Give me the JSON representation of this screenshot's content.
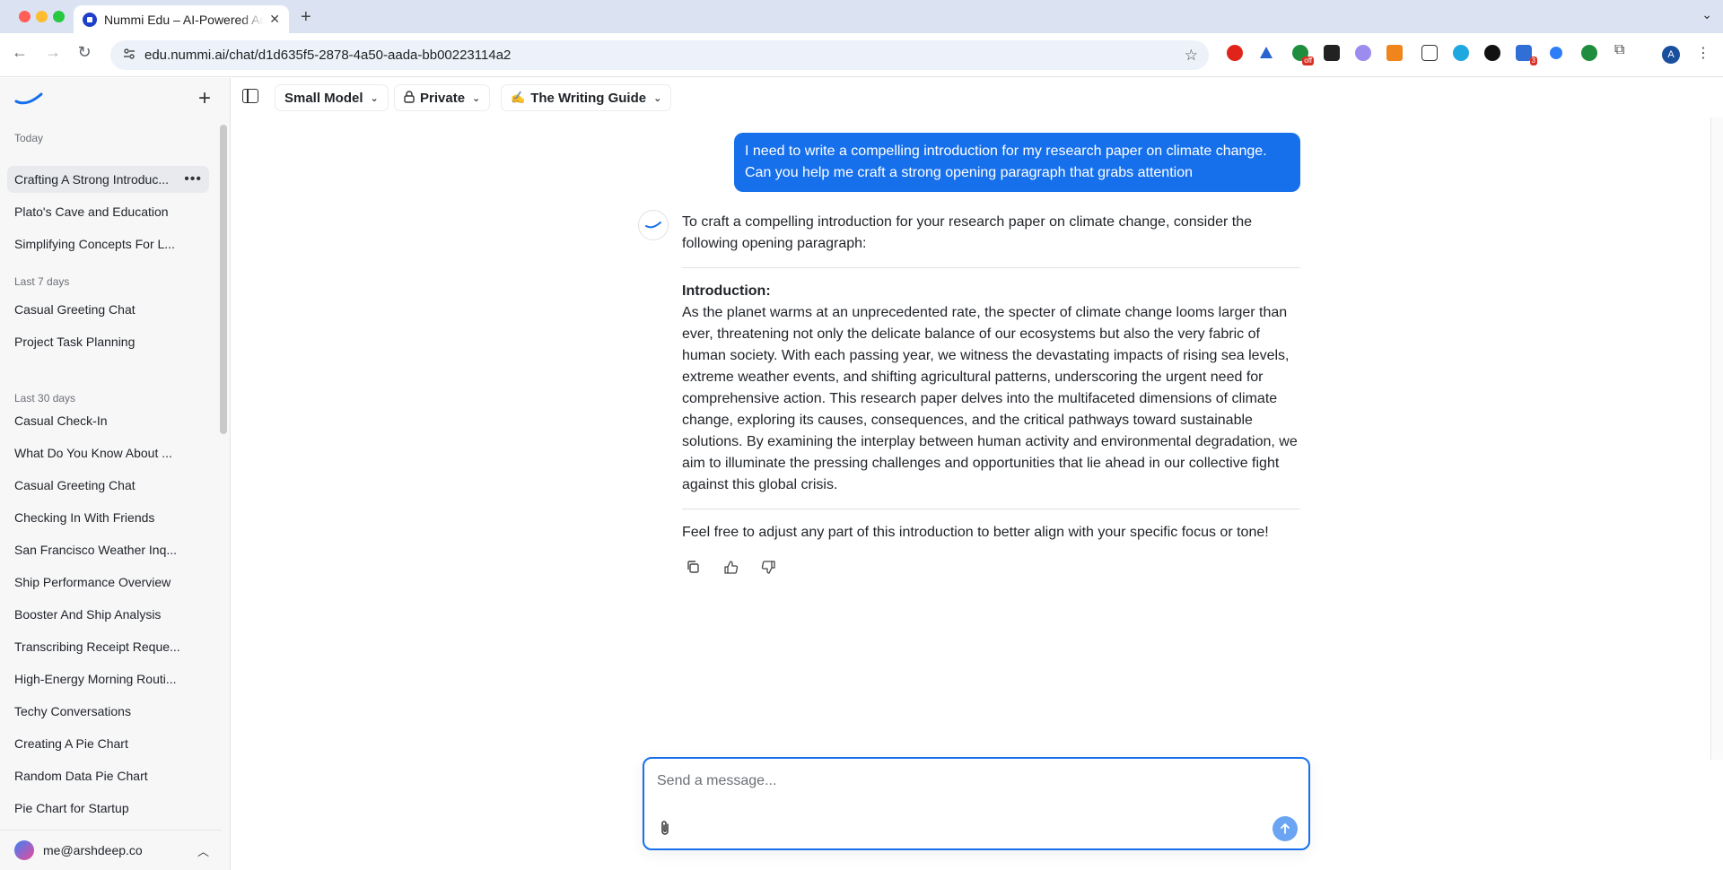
{
  "browser": {
    "tab_title": "Nummi Edu – AI-Powered Academic",
    "url": "edu.nummi.ai/chat/d1d635f5-2878-4a50-aada-bb00223114a2",
    "extensions": [
      "opera-icon",
      "drive-icon",
      "off-badge-extension-icon",
      "f-extension-icon",
      "chat-extension-icon",
      "metamask-icon",
      "tab-extension-icon",
      "globe-extension-icon",
      "dot-extension-icon",
      "grid-extension-icon",
      "blue-dot-extension-icon",
      "cursor-extension-icon",
      "puzzle-icon"
    ],
    "ext_badges": {
      "off": "off",
      "count": "3"
    },
    "profile_initial": "A"
  },
  "sidebar": {
    "sections": [
      {
        "label": "Today",
        "items": [
          "Crafting A Strong Introduc...",
          "Plato's Cave and Education",
          "Simplifying Concepts For L..."
        ]
      },
      {
        "label": "Last 7 days",
        "items": [
          "Casual Greeting Chat",
          "Project Task Planning"
        ]
      },
      {
        "label": "Last 30 days",
        "items": [
          "Casual Check-In",
          "What Do You Know About ...",
          "Casual Greeting Chat",
          "Checking In With Friends",
          "San Francisco Weather Inq...",
          "Ship Performance Overview",
          "Booster And Ship Analysis",
          "Transcribing Receipt Reque...",
          "High-Energy Morning Routi...",
          "Techy Conversations",
          "Creating A Pie Chart",
          "Random Data Pie Chart",
          "Pie Chart for Startup"
        ]
      }
    ],
    "active_item": "Crafting A Strong Introduc...",
    "user_email": "me@arshdeep.co"
  },
  "toolbar": {
    "model": "Small Model",
    "visibility": "Private",
    "guide_emoji": "✍️",
    "guide": "The Writing Guide"
  },
  "conversation": {
    "user_message": "I need to write a compelling introduction for my research paper on climate change. Can you help me craft a strong opening paragraph that grabs attention",
    "assistant_lead": "To craft a compelling introduction for your research paper on climate change, consider the following opening paragraph:",
    "assistant_heading": "Introduction:",
    "assistant_body": "As the planet warms at an unprecedented rate, the specter of climate change looms larger than ever, threatening not only the delicate balance of our ecosystems but also the very fabric of human society. With each passing year, we witness the devastating impacts of rising sea levels, extreme weather events, and shifting agricultural patterns, underscoring the urgent need for comprehensive action. This research paper delves into the multifaceted dimensions of climate change, exploring its causes, consequences, and the critical pathways toward sustainable solutions. By examining the interplay between human activity and environmental degradation, we aim to illuminate the pressing challenges and opportunities that lie ahead in our collective fight against this global crisis.",
    "assistant_closing": "Feel free to adjust any part of this introduction to better align with your specific focus or tone!"
  },
  "composer": {
    "placeholder": "Send a message...",
    "value": ""
  },
  "colors": {
    "accent": "#1670ec",
    "sidebar_bg": "#f7f7f8",
    "tabstrip_bg": "#dbe3f3"
  }
}
